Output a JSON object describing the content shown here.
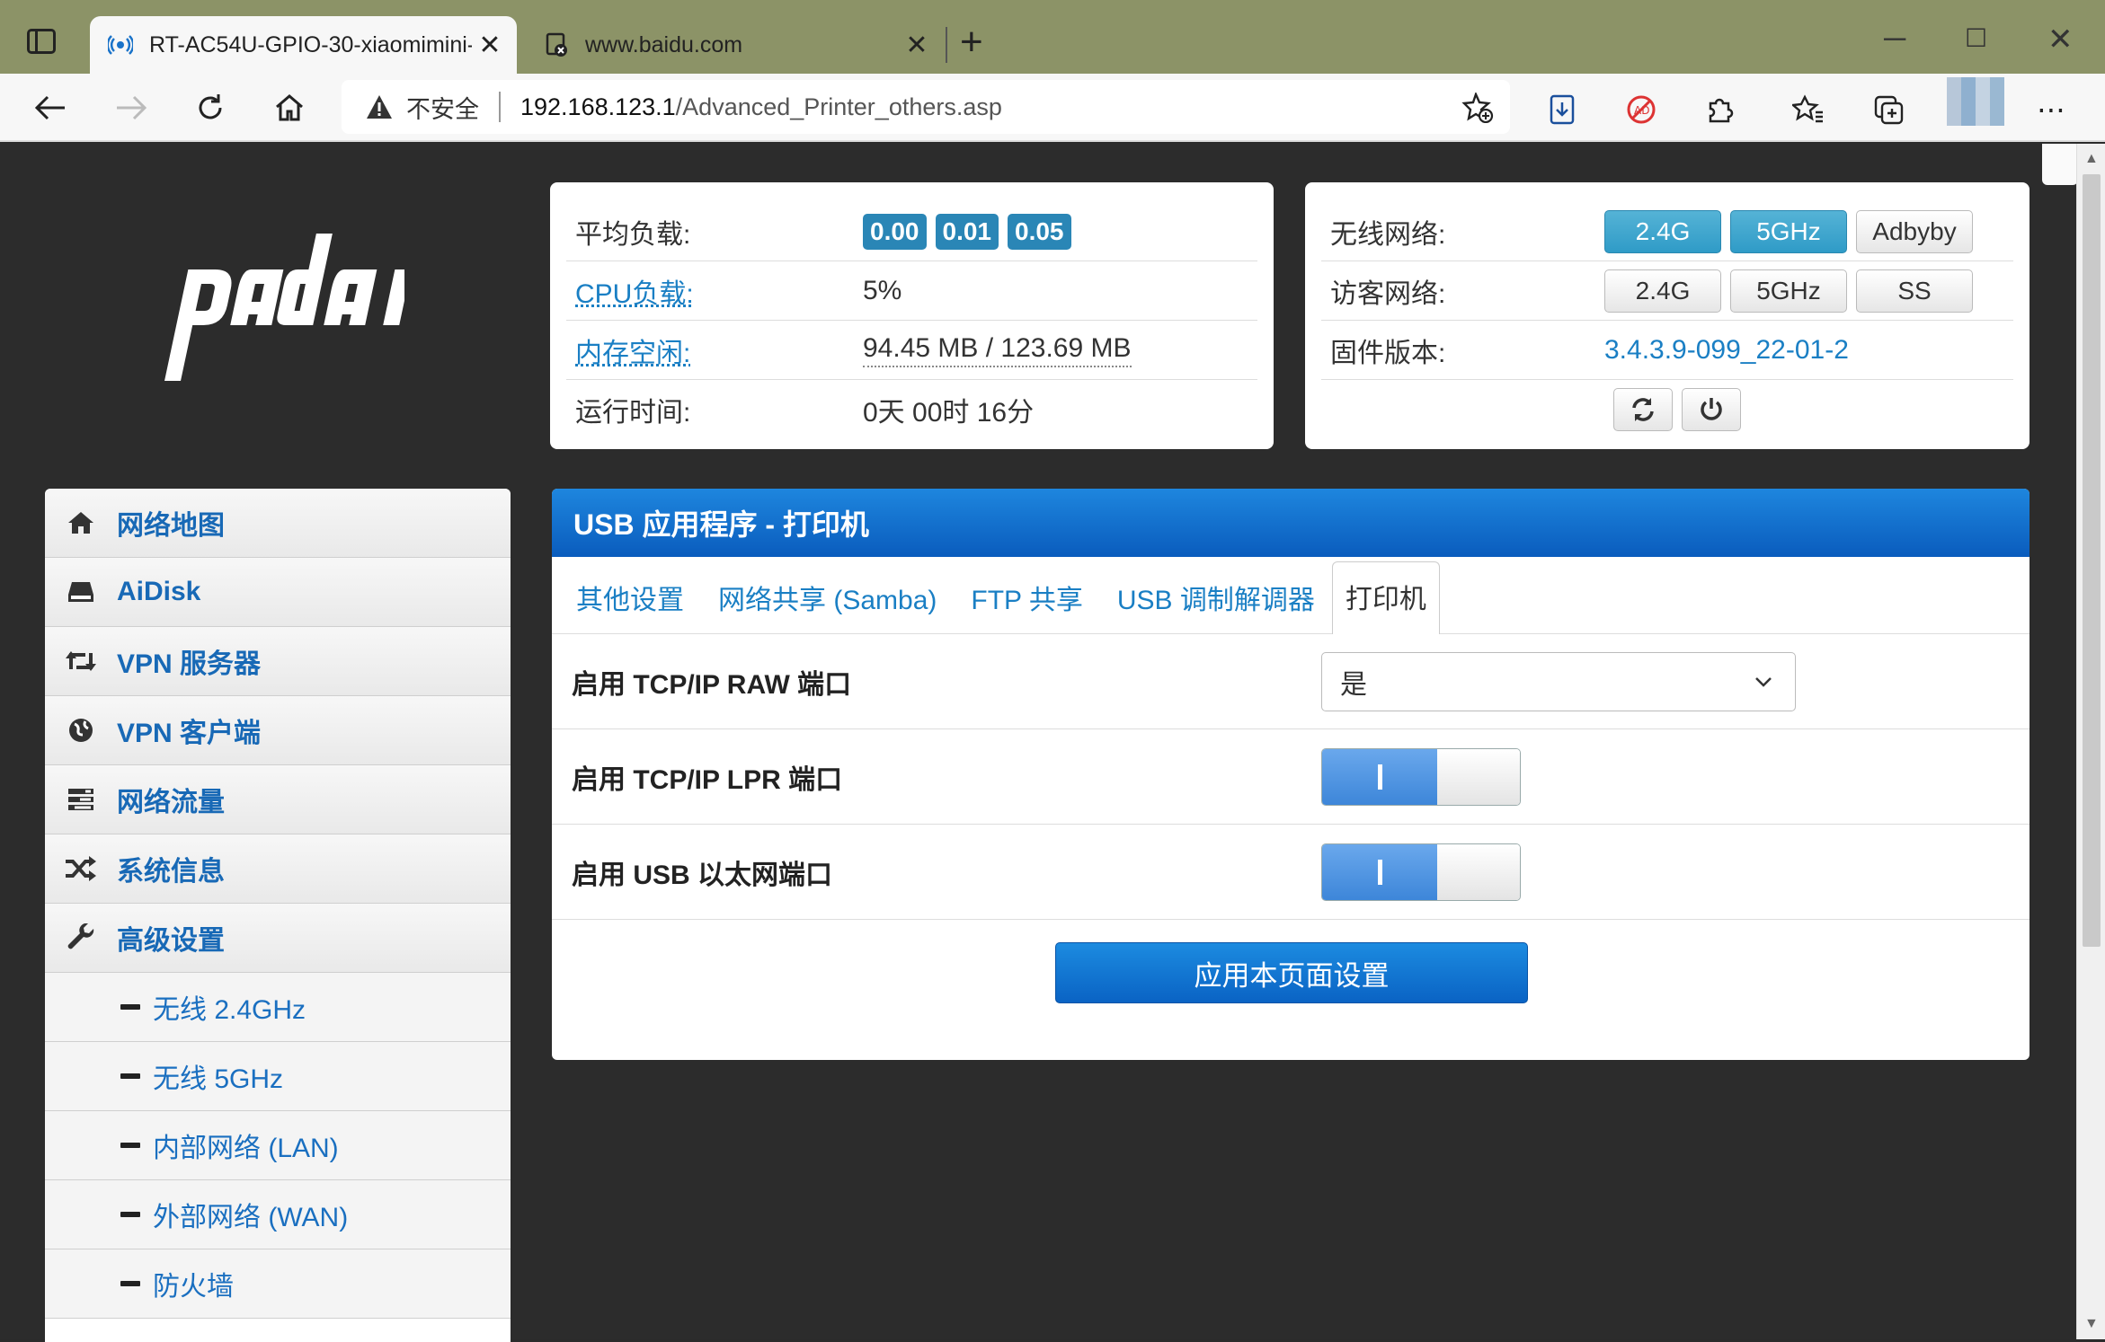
{
  "browser": {
    "tabs": [
      {
        "title": "RT-AC54U-GPIO-30-xiaomimini-",
        "active": true
      },
      {
        "title": "www.baidu.com",
        "active": false
      }
    ],
    "address": {
      "security": "不安全",
      "host": "192.168.123.1",
      "path": "/Advanced_Printer_others.asp"
    },
    "new_tab": "+"
  },
  "status": {
    "load_label": "平均负载:",
    "load_values": [
      "0.00",
      "0.01",
      "0.05"
    ],
    "cpu_label": "CPU负载:",
    "cpu_value": "5%",
    "mem_label": "内存空闲:",
    "mem_value": "94.45 MB / 123.69 MB",
    "uptime_label": "运行时间:",
    "uptime_value": "0天 00时 16分"
  },
  "wifi": {
    "wireless_label": "无线网络:",
    "wireless_buttons": [
      "2.4G",
      "5GHz",
      "Adbyby"
    ],
    "guest_label": "访客网络:",
    "guest_buttons": [
      "2.4G",
      "5GHz",
      "SS"
    ],
    "firmware_label": "固件版本:",
    "firmware_value": "3.4.3.9-099_22-01-2"
  },
  "sidebar": {
    "items": [
      {
        "label": "网络地图",
        "icon": "home-icon"
      },
      {
        "label": "AiDisk",
        "icon": "hdd-icon"
      },
      {
        "label": "VPN 服务器",
        "icon": "retweet-icon"
      },
      {
        "label": "VPN 客户端",
        "icon": "globe-icon"
      },
      {
        "label": "网络流量",
        "icon": "tasks-icon"
      },
      {
        "label": "系统信息",
        "icon": "random-icon"
      },
      {
        "label": "高级设置",
        "icon": "wrench-icon"
      }
    ],
    "subitems": [
      "无线 2.4GHz",
      "无线 5GHz",
      "内部网络 (LAN)",
      "外部网络 (WAN)",
      "防火墙"
    ]
  },
  "main": {
    "title": "USB 应用程序 - 打印机",
    "tabs": [
      "其他设置",
      "网络共享 (Samba)",
      "FTP 共享",
      "USB 调制解调器",
      "打印机"
    ],
    "rows": [
      {
        "label": "启用 TCP/IP RAW 端口",
        "value": "是"
      },
      {
        "label": "启用 TCP/IP LPR 端口",
        "toggle_on": true,
        "toggle_text": "I"
      },
      {
        "label": "启用 USB 以太网端口",
        "toggle_on": true,
        "toggle_text": "I"
      }
    ],
    "apply_label": "应用本页面设置"
  },
  "colors": {
    "accent": "#2a86b6",
    "header_blue": "#0a5cbd",
    "link": "#1a7fc4",
    "tab_strip": "#8c9367"
  }
}
